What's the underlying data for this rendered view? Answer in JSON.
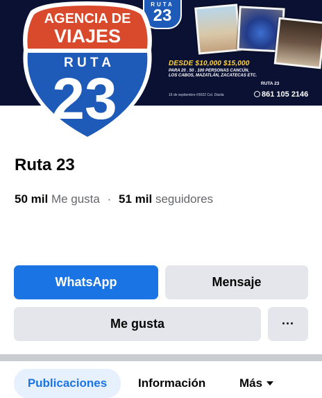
{
  "cover": {
    "tiny_sign": {
      "top": "RUTA",
      "number": "23"
    },
    "promo_price": "DESDE $10,000 $15,000",
    "promo_details": "PARA 20 . 50 . 100 PERSONAS CANCÚN, LOS CABOS, MAZATLÁN, ZACATECAS ETC.",
    "social_handle": "RUTA 23",
    "address": "16 de septiembre #3022 Col. Dávila",
    "phone": "861 105 2146"
  },
  "logo": {
    "line1": "AGENCIA DE",
    "line2": "VIAJES",
    "route": "R U T A",
    "number": "23"
  },
  "page": {
    "name": "Ruta 23"
  },
  "stats": {
    "likes_count": "50 mil",
    "likes_label": "Me gusta",
    "separator": "·",
    "followers_count": "51 mil",
    "followers_label": "seguidores"
  },
  "actions": {
    "whatsapp": "WhatsApp",
    "message": "Mensaje",
    "like": "Me gusta",
    "more": "···"
  },
  "tabs": [
    {
      "label": "Publicaciones",
      "active": true
    },
    {
      "label": "Información",
      "active": false
    },
    {
      "label": "Más",
      "active": false
    }
  ],
  "colors": {
    "primary_blue": "#1b74e4",
    "cover_bg": "#0b1133",
    "logo_red": "#d84a2b",
    "logo_blue": "#1e5bb8",
    "promo_yellow": "#ffd33d"
  }
}
